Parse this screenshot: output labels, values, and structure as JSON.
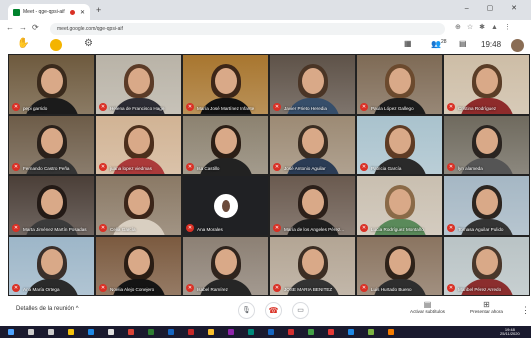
{
  "browser": {
    "tab_title": "Meet - qge-qpsi-aif",
    "url": "meet.google.com/qge-qpsi-aif",
    "new_tab_glyph": "+",
    "window_controls": "– ▢ ✕"
  },
  "meet_top": {
    "time": "19:48",
    "people_count": "28"
  },
  "participants": [
    {
      "name": "pepi garrido",
      "bg": "#6e5a3e",
      "hair": "#3a2a1c",
      "shirt": "#1b1b1b"
    },
    {
      "name": "Helena de Francisco Hage",
      "bg": "#b9b3a7",
      "hair": "#5b3b27",
      "shirt": "#2c2c34"
    },
    {
      "name": "María José Martínez Infante",
      "bg": "#a8762f",
      "hair": "#3c2618",
      "shirt": "#111"
    },
    {
      "name": "Javier Prieto Heredia",
      "bg": "#5e5248",
      "hair": "#4a3526",
      "shirt": "#364e6a"
    },
    {
      "name": "Paula López Gallego",
      "bg": "#7e6a55",
      "hair": "#6b4a2e",
      "shirt": "#1c1c1c"
    },
    {
      "name": "Cristina Rodríguez",
      "bg": "#cdbda6",
      "hair": "#5a3d27",
      "shirt": "#8e2b2b"
    },
    {
      "name": "Fernando Castro Peña",
      "bg": "#6d5c48",
      "hair": "#2a211b",
      "shirt": "#343434"
    },
    {
      "name": "juana lopez viedmas",
      "bg": "#d1b394",
      "hair": "#4c2f1c",
      "shirt": "#ab3a3a"
    },
    {
      "name": "Isa Castillo",
      "bg": "#8c8270",
      "hair": "#2b1e15",
      "shirt": "#222"
    },
    {
      "name": "José Antonio Aguilar",
      "bg": "#9c8a74",
      "hair": "#3a2d22",
      "shirt": "#2b3c55"
    },
    {
      "name": "Patricia García",
      "bg": "#a9c2cd",
      "hair": "#5e3b24",
      "shirt": "#2a2a2a"
    },
    {
      "name": "lyn alameda",
      "bg": "#6f6a5e",
      "hair": "#2a2420",
      "shirt": "#555"
    },
    {
      "name": "Marta Jiménez Martín Posadas",
      "bg": "#4b3f38",
      "hair": "#231a16",
      "shirt": "#3b3b3b"
    },
    {
      "name": "Celia García",
      "bg": "#8a7965",
      "hair": "#3b2519",
      "shirt": "#d9cfc1"
    },
    {
      "name": "Ana Morales",
      "dark": true
    },
    {
      "name": "María de los Angeles Pérez...",
      "bg": "#6a5a4f",
      "hair": "#2c201a",
      "shirt": "#1f1f1f"
    },
    {
      "name": "Lucía Rodríguez Montaño",
      "bg": "#c9bfb0",
      "hair": "#8a6a48",
      "shirt": "#5a8a5a"
    },
    {
      "name": "Tomasa Aguilar Pulido",
      "bg": "#a5b7c4",
      "hair": "#2c2520",
      "shirt": "#343434"
    },
    {
      "name": "Ana María Ortega",
      "bg": "#9db6c8",
      "hair": "#3a2f2a",
      "shirt": "#2a2a2a"
    },
    {
      "name": "Noelia Alejo Conejero",
      "bg": "#7b5a3f",
      "hair": "#2a1d14",
      "shirt": "#141414"
    },
    {
      "name": "Isabel Ramírez",
      "bg": "#8c8074",
      "hair": "#2f241d",
      "shirt": "#262626"
    },
    {
      "name": "JOSE MARIA BENITEZ",
      "bg": "#b3a594",
      "hair": "#3c2e24",
      "shirt": "#333"
    },
    {
      "name": "Luis Hurtado Bueno",
      "bg": "#8a7460",
      "hair": "#2e2219",
      "shirt": "#2e2e2e"
    },
    {
      "name": "Maribel Pérez Arredo",
      "bg": "#b9c3c5",
      "hair": "#49372b",
      "shirt": "#8b2e2e"
    }
  ],
  "bottom": {
    "details": "Detalles de la reunión ^",
    "captions": "Activar subtítulos",
    "present": "Presentar ahora",
    "more": "⋮"
  },
  "taskbar": {
    "time": "19:48",
    "date": "25/11/2020"
  },
  "icons": {
    "mic": "mic-icon",
    "hangup": "phone-hangup-icon",
    "camera": "camera-icon",
    "hand": "raise-hand-icon",
    "gear": "gear-icon"
  }
}
